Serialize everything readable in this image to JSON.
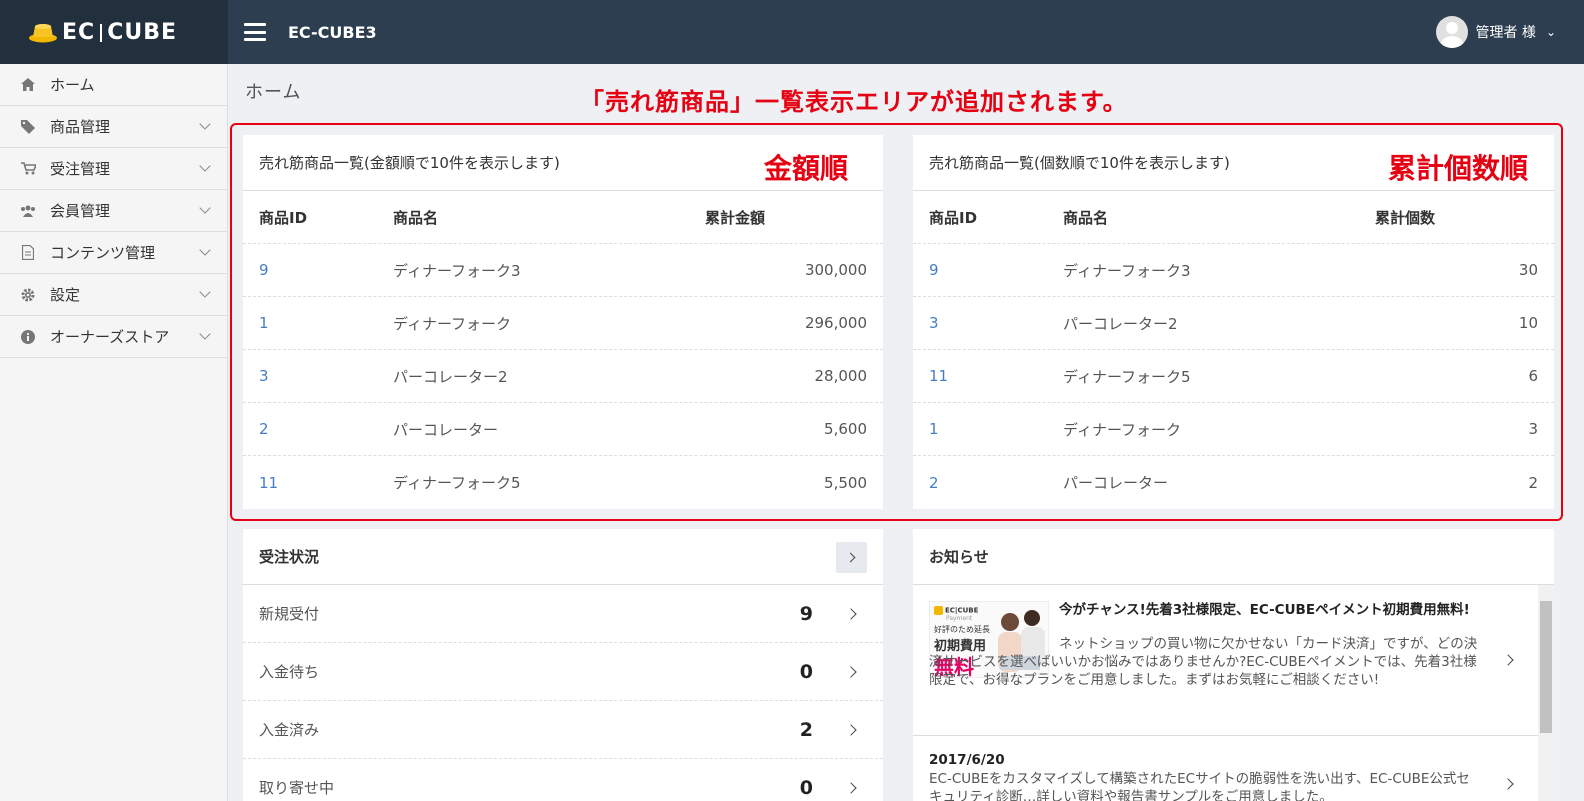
{
  "header": {
    "logo_left": "EC",
    "logo_right": "CUBE",
    "shop_name": "EC-CUBE3",
    "user": "管理者 様"
  },
  "sidebar": {
    "items": [
      {
        "label": "ホーム",
        "icon": "home-icon"
      },
      {
        "label": "商品管理",
        "icon": "tag-icon"
      },
      {
        "label": "受注管理",
        "icon": "cart-icon"
      },
      {
        "label": "会員管理",
        "icon": "users-icon"
      },
      {
        "label": "コンテンツ管理",
        "icon": "file-icon"
      },
      {
        "label": "設定",
        "icon": "gear-icon"
      },
      {
        "label": "オーナーズストア",
        "icon": "info-icon"
      }
    ]
  },
  "breadcrumb": "ホーム",
  "announcement": "「売れ筋商品」一覧表示エリアが追加されます。",
  "colors": {
    "header": "#2c3e50",
    "logo_bg": "#22303e",
    "accent_red": "#e50012",
    "link": "#437ec4"
  },
  "amount_table": {
    "title": "売れ筋商品一覧(金額順で10件を表示します)",
    "label": "金額順",
    "headers": [
      "商品ID",
      "商品名",
      "累計金額"
    ],
    "rows": [
      {
        "id": "9",
        "name": "ディナーフォーク3",
        "value": "300,000"
      },
      {
        "id": "1",
        "name": "ディナーフォーク",
        "value": "296,000"
      },
      {
        "id": "3",
        "name": "パーコレーター2",
        "value": "28,000"
      },
      {
        "id": "2",
        "name": "パーコレーター",
        "value": "5,600"
      },
      {
        "id": "11",
        "name": "ディナーフォーク5",
        "value": "5,500"
      }
    ]
  },
  "count_table": {
    "title": "売れ筋商品一覧(個数順で10件を表示します)",
    "label": "累計個数順",
    "headers": [
      "商品ID",
      "商品名",
      "累計個数"
    ],
    "rows": [
      {
        "id": "9",
        "name": "ディナーフォーク3",
        "value": "30"
      },
      {
        "id": "3",
        "name": "パーコレーター2",
        "value": "10"
      },
      {
        "id": "11",
        "name": "ディナーフォーク5",
        "value": "6"
      },
      {
        "id": "1",
        "name": "ディナーフォーク",
        "value": "3"
      },
      {
        "id": "2",
        "name": "パーコレーター",
        "value": "2"
      }
    ]
  },
  "order_status": {
    "title": "受注状況",
    "rows": [
      {
        "label": "新規受付",
        "count": "9"
      },
      {
        "label": "入金待ち",
        "count": "0"
      },
      {
        "label": "入金済み",
        "count": "2"
      },
      {
        "label": "取り寄せ中",
        "count": "0"
      }
    ]
  },
  "news": {
    "title": "お知らせ",
    "items": [
      {
        "image_brand_left": "EC",
        "image_brand_right": "CUBE",
        "image_brand_sub": "Payment",
        "image_tag": "好評のため延長",
        "image_title": "初期費用",
        "image_free": "無料",
        "headline": "今がチャンス!先着3社様限定、EC-CUBEペイメント初期費用無料!",
        "body": "ネットショップの買い物に欠かせない「カード決済」ですが、どの決済サービスを選べばいいかお悩みではありませんか?EC-CUBEペイメントでは、先着3社様限定で、お得なプランをご用意しました。まずはお気軽にご相談ください!"
      },
      {
        "date": "2017/6/20",
        "body": "EC-CUBEをカスタマイズして構築されたECサイトの脆弱性を洗い出す、EC-CUBE公式セキュリティ診断…詳しい資料や報告書サンプルをご用意しました。"
      }
    ]
  }
}
